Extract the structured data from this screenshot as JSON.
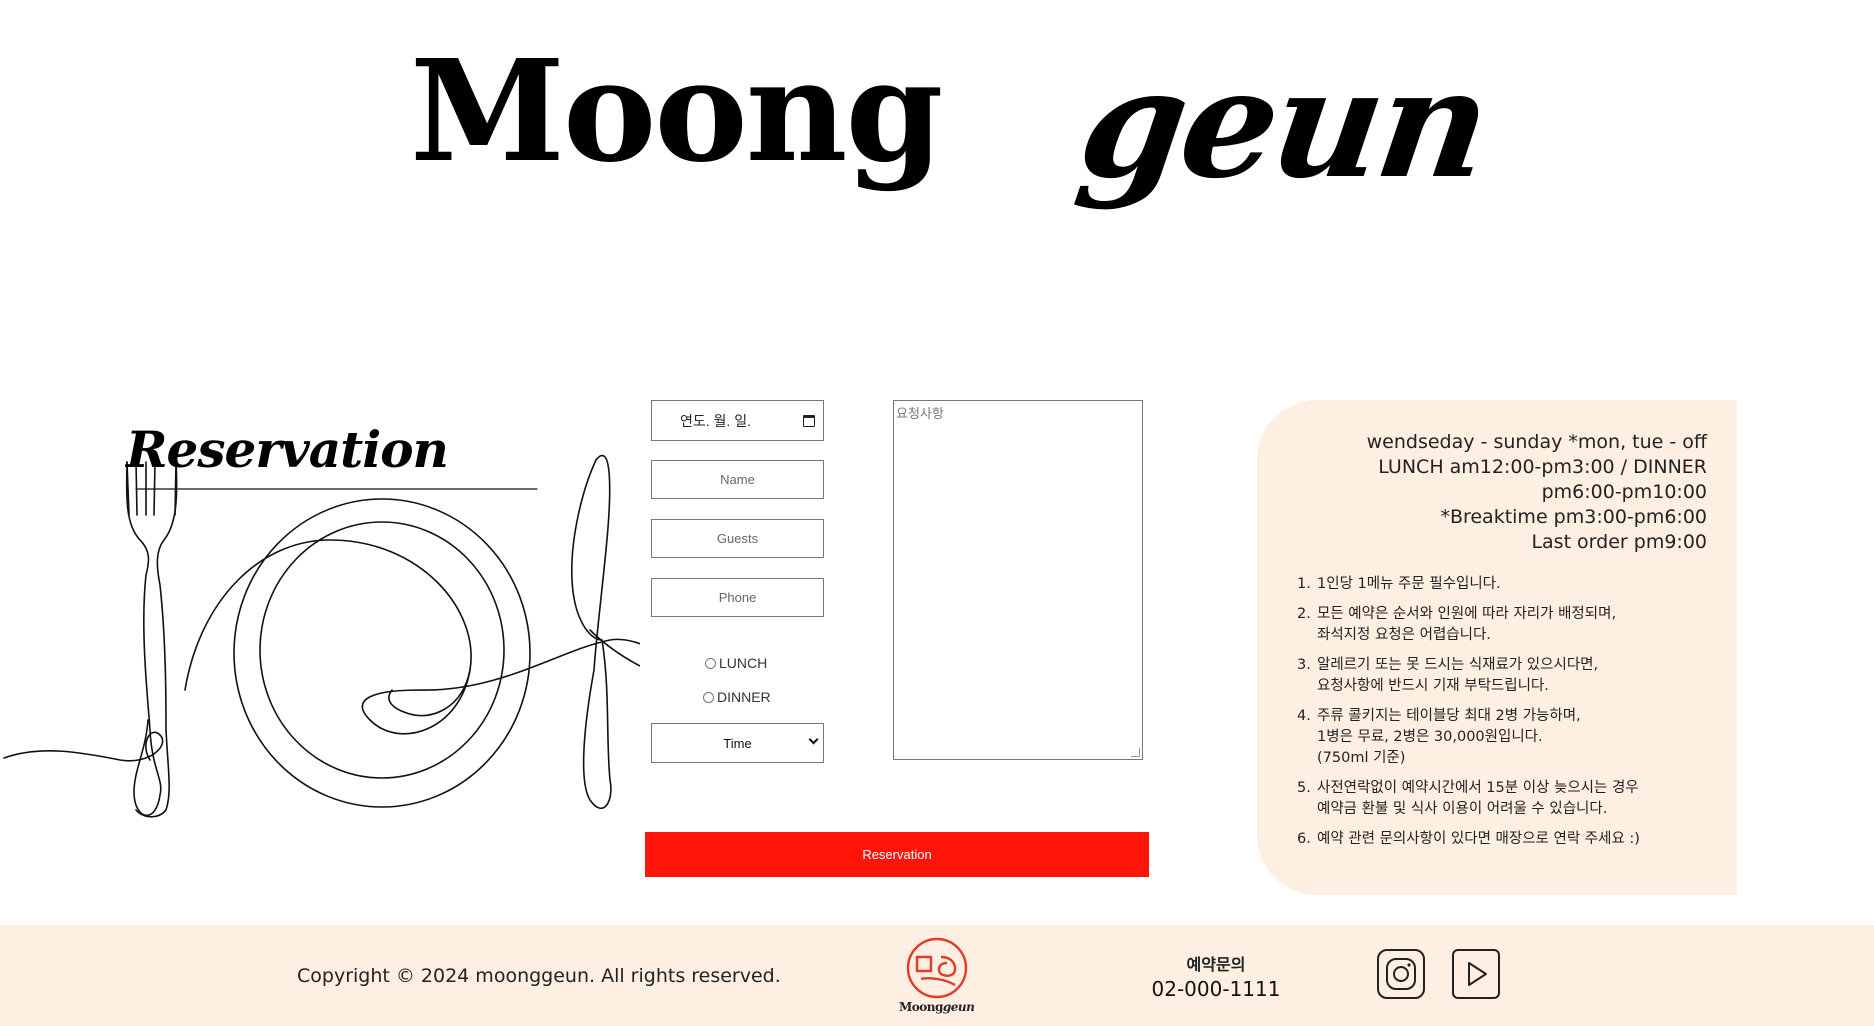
{
  "brand": {
    "logo_prefix": "Moong",
    "logo_suffix": "geun"
  },
  "section": {
    "title": "Reservation"
  },
  "form": {
    "date_placeholder": "연도. 월. 일.",
    "name_placeholder": "Name",
    "guests_placeholder": "Guests",
    "phone_placeholder": "Phone",
    "radio_lunch": "LUNCH",
    "radio_dinner": "DINNER",
    "time_select": "Time",
    "request_placeholder": "요청사항",
    "submit_label": "Reservation"
  },
  "info": {
    "hours": [
      "wendseday - sunday *mon, tue - off",
      "LUNCH am12:00-pm3:00 / DINNER",
      "pm6:00-pm10:00",
      "*Breaktime pm3:00-pm6:00",
      "Last order pm9:00"
    ],
    "rules": [
      {
        "num": "1.",
        "lines": [
          "1인당 1메뉴 주문 필수입니다."
        ]
      },
      {
        "num": "2.",
        "lines": [
          "모든 예약은 순서와 인원에 따라 자리가 배정되며,",
          "좌석지정 요청은 어렵습니다."
        ]
      },
      {
        "num": "3.",
        "lines": [
          "알레르기 또는 못 드시는 식재료가 있으시다면,",
          "요청사항에 반드시 기재 부탁드립니다."
        ]
      },
      {
        "num": "4.",
        "lines": [
          "주류 콜키지는 테이블당 최대 2병 가능하며,",
          "1병은 무료, 2병은 30,000원입니다.",
          "(750ml 기준)"
        ]
      },
      {
        "num": "5.",
        "lines": [
          "사전연락없이 예약시간에서 15분 이상 늦으시는 경우",
          "예약금 환불 및 식사 이용이 어려울 수 있습니다."
        ]
      },
      {
        "num": "6.",
        "lines": [
          "예약 관련 문의사항이 있다면 매장으로 연락 주세요 :)"
        ]
      }
    ]
  },
  "footer": {
    "copyright": "Copyright © 2024 moonggeun. All rights reserved.",
    "mini_logo_prefix": "Moong",
    "mini_logo_suffix": "geun",
    "contact_label": "예약문의",
    "contact_phone": "02-000-1111"
  },
  "colors": {
    "accent": "#fc1508",
    "panel_bg": "#fdefe1",
    "logo_red": "#e23a2b"
  },
  "icons": [
    "calendar-icon",
    "chevron-down-icon",
    "instagram-icon",
    "youtube-play-icon"
  ]
}
